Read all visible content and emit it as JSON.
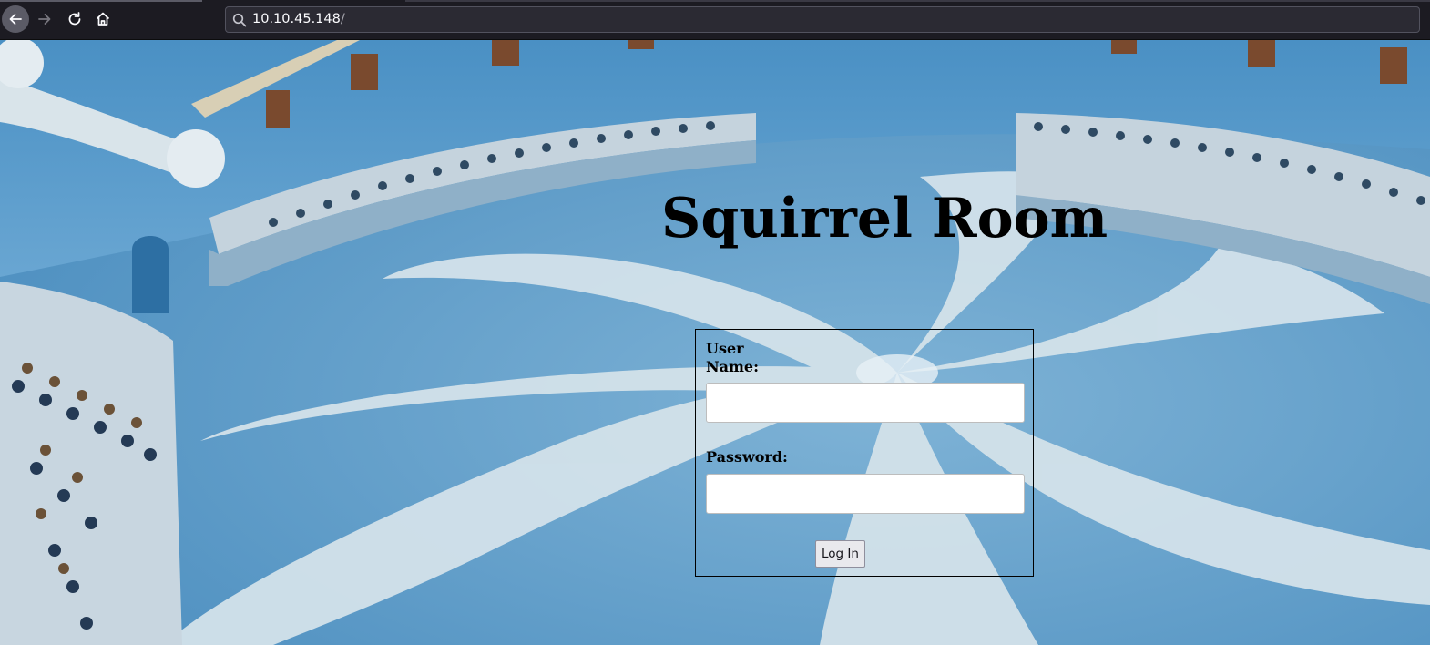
{
  "browser": {
    "url_host": "10.10.45.148",
    "url_path": "/",
    "icons": {
      "back": "arrow-left-icon",
      "forward": "arrow-right-icon",
      "reload": "reload-icon",
      "home": "home-icon",
      "search": "search-icon"
    }
  },
  "page": {
    "title": "Squirrel Room",
    "form": {
      "username_label": "User Name:",
      "username_value": "",
      "password_label": "Password:",
      "password_value": "",
      "submit_label": "Log In"
    }
  },
  "colors": {
    "toolbar_bg": "#1c1b22",
    "urlbar_bg": "#2b2a33",
    "floor_blue": "#5b9bc7",
    "floor_swirl": "#d6e4ec"
  }
}
